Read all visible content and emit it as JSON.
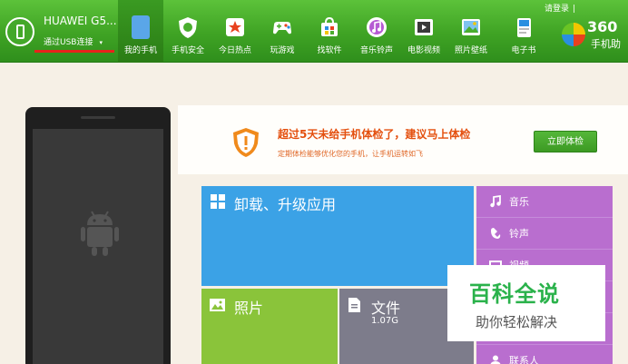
{
  "device": {
    "name": "HUAWEI G5...",
    "connection": "通过USB连接",
    "connection_caret": "▾"
  },
  "nav": [
    {
      "label": "我的手机",
      "icon": "my-phone-icon",
      "active": true
    },
    {
      "label": "手机安全",
      "icon": "security-shield-icon"
    },
    {
      "label": "今日热点",
      "icon": "hot-star-icon"
    },
    {
      "label": "玩游戏",
      "icon": "gamepad-icon"
    },
    {
      "label": "找软件",
      "icon": "software-bag-icon"
    },
    {
      "label": "音乐铃声",
      "icon": "music-note-icon"
    },
    {
      "label": "电影视频",
      "icon": "film-icon"
    },
    {
      "label": "照片壁纸",
      "icon": "photo-icon"
    },
    {
      "label": "电子书",
      "icon": "ebook-icon"
    }
  ],
  "login": {
    "label": "请登录",
    "separator": "|"
  },
  "logo": {
    "top": "360",
    "bottom": "手机助"
  },
  "banner": {
    "title": "超过5天未给手机体检了，建议马上体检",
    "subtitle": "定期体检能够优化您的手机，让手机运转如飞",
    "button": "立即体检"
  },
  "tiles": {
    "apps": {
      "title": "卸载、升级应用"
    },
    "photos": {
      "title": "照片"
    },
    "files": {
      "title": "文件",
      "size": "1.07G"
    }
  },
  "side_items": [
    {
      "label": "音乐",
      "icon": "music-note-icon"
    },
    {
      "label": "铃声",
      "icon": "ringtone-icon"
    },
    {
      "label": "视频",
      "icon": "video-icon"
    },
    {
      "label": "",
      "icon": "blank-icon"
    },
    {
      "label": "",
      "icon": "blank-icon"
    },
    {
      "label": "联系人",
      "icon": "contact-icon"
    }
  ],
  "watermark": {
    "main": "百科全说",
    "sub": "助你轻松解决"
  },
  "colors": {
    "topbar": "#3fa324",
    "apps_tile": "#3ba2e6",
    "photos_tile": "#8ac43a",
    "files_tile": "#7d7c8b",
    "side_tile": "#b96ecf",
    "banner_title": "#e44f0e",
    "usb_underline": "#e8231b"
  }
}
